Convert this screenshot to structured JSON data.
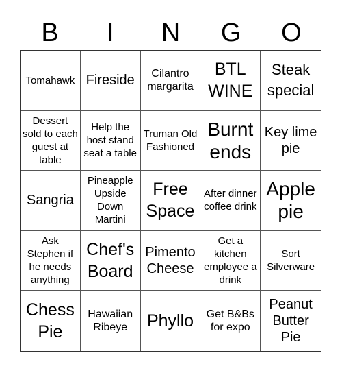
{
  "header": [
    "B",
    "I",
    "N",
    "G",
    "O"
  ],
  "cells": [
    "Tomahawk",
    "Fireside",
    "Cilantro margarita",
    "BTL WINE",
    "Steak special",
    "Dessert sold to each guest at table",
    "Help the host stand seat a table",
    "Truman Old Fashioned",
    "Burnt ends",
    "Key lime pie",
    "Sangria",
    "Pineapple Upside Down Martini",
    "Free Space",
    "After dinner coffee drink",
    "Apple pie",
    "Ask Stephen if he needs anything",
    "Chef's Board",
    "Pimento Cheese",
    "Get a kitchen employee a drink",
    "Sort Silverware",
    "Chess Pie",
    "Hawaiian Ribeye",
    "Phyllo",
    "Get B&Bs for expo",
    "Peanut Butter Pie"
  ]
}
